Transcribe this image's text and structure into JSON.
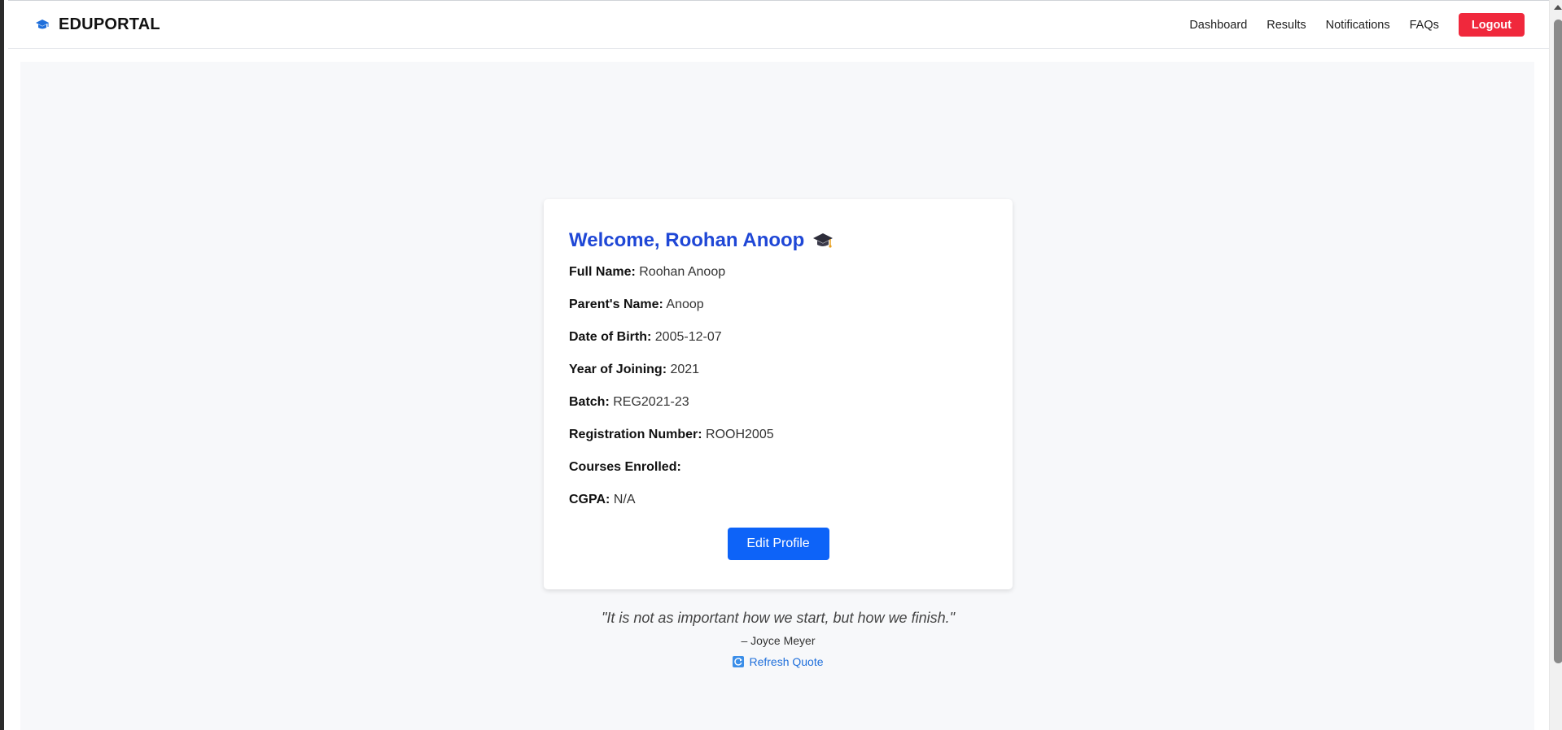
{
  "navbar": {
    "brand": "EDUPORTAL",
    "brand_icon": "graduation-cap-icon",
    "links": [
      "Dashboard",
      "Results",
      "Notifications",
      "FAQs"
    ],
    "logout_label": "Logout"
  },
  "profile": {
    "welcome": "Welcome, Roohan Anoop",
    "welcome_icon": "graduation-cap-emoji",
    "fields": [
      {
        "label": "Full Name:",
        "value": "Roohan Anoop"
      },
      {
        "label": "Parent's Name:",
        "value": "Anoop"
      },
      {
        "label": "Date of Birth:",
        "value": "2005-12-07"
      },
      {
        "label": "Year of Joining:",
        "value": "2021"
      },
      {
        "label": "Batch:",
        "value": "REG2021-23"
      },
      {
        "label": "Registration Number:",
        "value": "ROOH2005"
      },
      {
        "label": "Courses Enrolled:",
        "value": ""
      },
      {
        "label": "CGPA:",
        "value": "N/A"
      }
    ],
    "edit_label": "Edit Profile"
  },
  "quote": {
    "text": "\"It is not as important how we start, but how we finish.\"",
    "author": "– Joyce Meyer",
    "refresh_label": "Refresh Quote",
    "refresh_icon": "refresh-icon"
  },
  "colors": {
    "accent": "#1f47d6",
    "button_primary": "#0d63f8",
    "logout": "#f0283c",
    "background": "#f7f8fa"
  }
}
